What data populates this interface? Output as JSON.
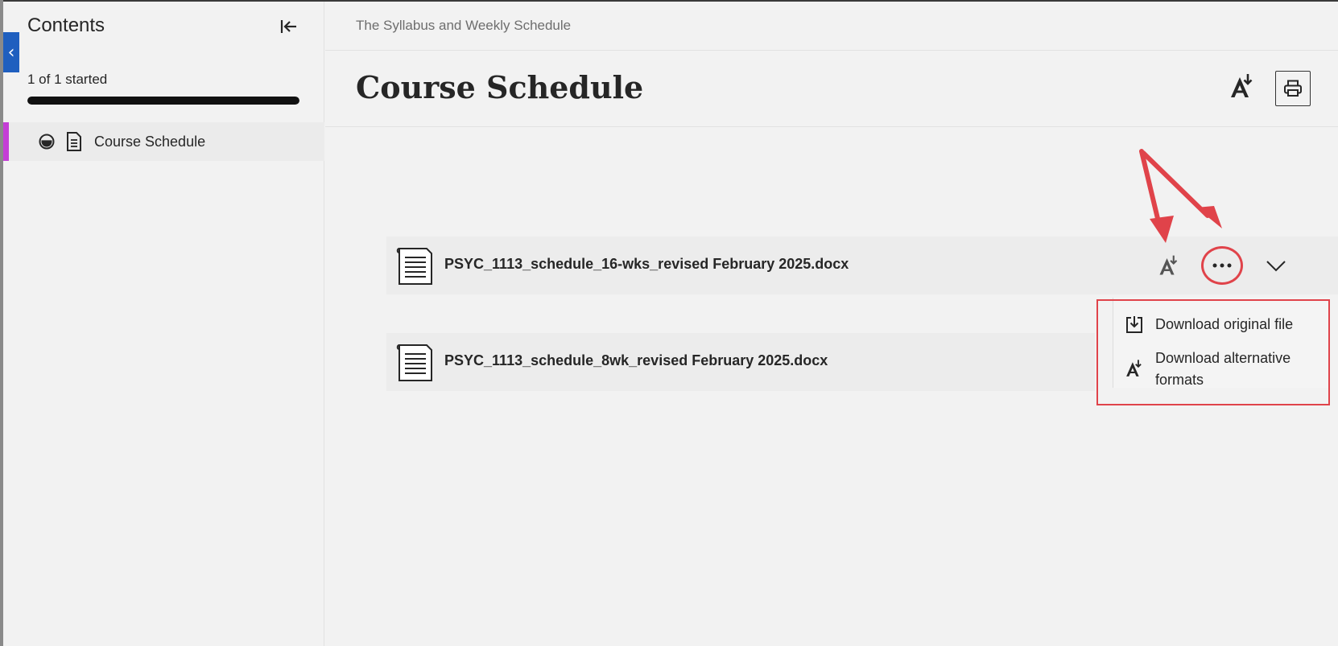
{
  "sidebar": {
    "title": "Contents",
    "progress_label": "1 of 1 started",
    "progress_fraction": 1.0,
    "items": [
      {
        "label": "Course Schedule",
        "status": "started",
        "type": "document"
      }
    ],
    "accent_color": "#c43ed6"
  },
  "breadcrumb": "The Syllabus and Weekly Schedule",
  "page": {
    "title": "Course Schedule"
  },
  "files": [
    {
      "name": "PSYC_1113_schedule_16-wks_revised February 2025.docx"
    },
    {
      "name": "PSYC_1113_schedule_8wk_revised February 2025.docx"
    }
  ],
  "menu": {
    "items": [
      {
        "label": "Download original file",
        "icon": "download-icon"
      },
      {
        "label": "Download alternative",
        "label2": "formats",
        "icon": "alternative-formats-icon"
      }
    ]
  },
  "colors": {
    "annotation_red": "#e0434a",
    "back_tab_blue": "#1f5fbf"
  }
}
